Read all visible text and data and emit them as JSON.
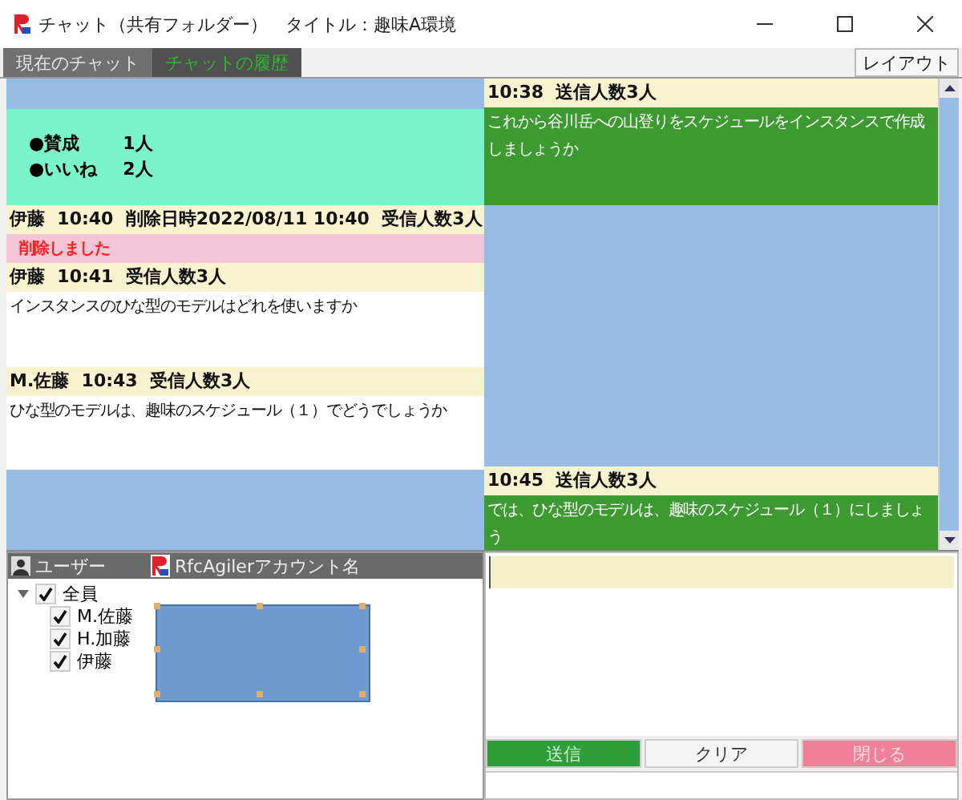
{
  "window": {
    "title": "チャット（共有フォルダー）　タイトル：趣味A環境"
  },
  "tabs": [
    {
      "label": "現在のチャット",
      "selected": false
    },
    {
      "label": "チャットの履歴",
      "selected": true
    }
  ],
  "layout_button": "レイアウト",
  "left_messages": [
    {
      "kind": "reactions",
      "lines": [
        {
          "label": "●賛成",
          "count": "1人"
        },
        {
          "label": "●いいね",
          "count": "2人"
        }
      ]
    },
    {
      "kind": "deleted",
      "header": "伊藤  10:40  削除日時2022/08/11 10:40  受信人数3人",
      "body": "削除しました"
    },
    {
      "kind": "message",
      "header": "伊藤  10:41  受信人数3人",
      "body": "インスタンスのひな型のモデルはどれを使いますか"
    },
    {
      "kind": "message",
      "header": "M.佐藤  10:43  受信人数3人",
      "body": "ひな型のモデルは、趣味のスケジュール（１）でどうでしょうか"
    }
  ],
  "right_messages": [
    {
      "header": "10:38  送信人数3人",
      "body": "これから谷川岳への山登りをスケジュールをインスタンスで作成しましょうか"
    },
    {
      "header": "10:45  送信人数3人",
      "body": "では、ひな型のモデルは、趣味のスケジュール（１）にしましょう"
    }
  ],
  "user_panel": {
    "columns": [
      "ユーザー",
      "RfcAgilerアカウント名"
    ],
    "tree": [
      {
        "label": "全員",
        "checked": true,
        "expanded": true,
        "children": [
          {
            "label": "M.佐藤",
            "checked": true
          },
          {
            "label": "H.加藤",
            "checked": true
          },
          {
            "label": "伊藤",
            "checked": true
          }
        ]
      }
    ]
  },
  "buttons": [
    {
      "kind": "send",
      "label": "送信"
    },
    {
      "kind": "clear",
      "label": "クリア"
    },
    {
      "kind": "close",
      "label": "閉じる"
    }
  ]
}
